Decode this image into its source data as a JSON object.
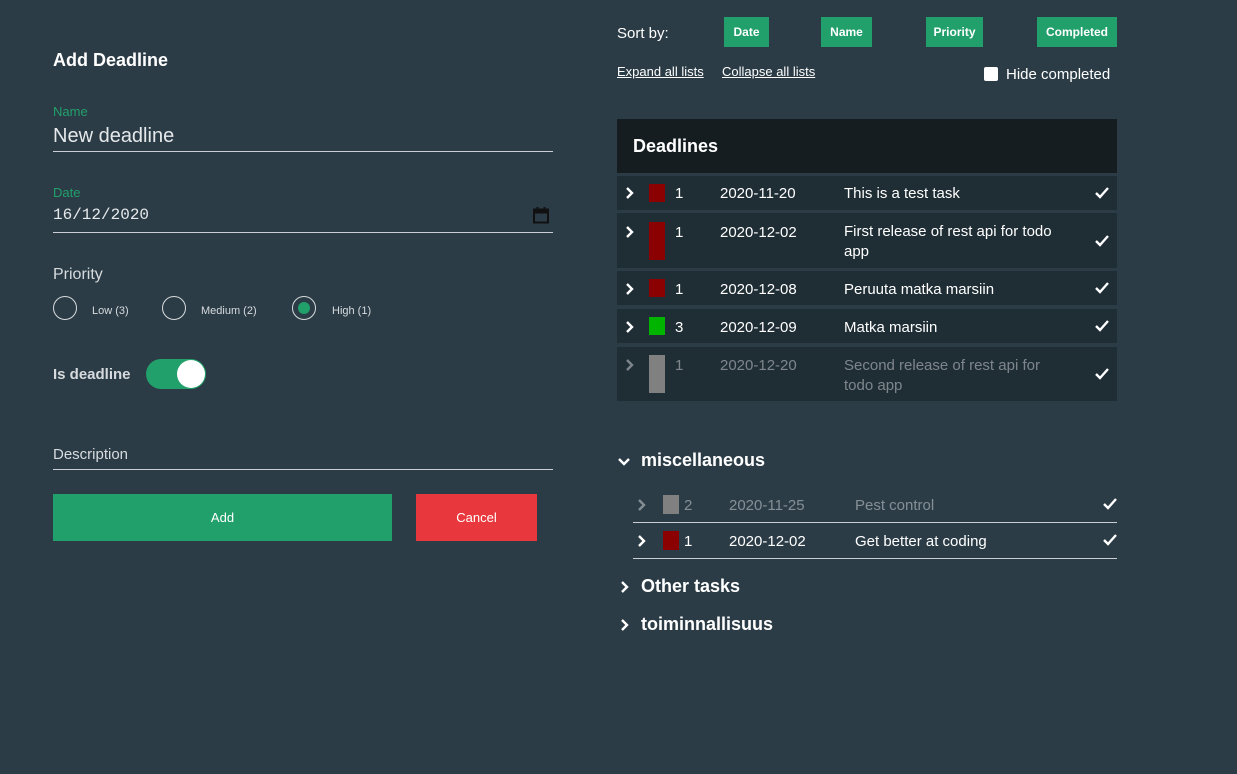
{
  "form": {
    "title": "Add Deadline",
    "name_label": "Name",
    "name_value": "New deadline",
    "date_label": "Date",
    "date_value": "16/12/2020",
    "priority_title": "Priority",
    "priority_options": [
      {
        "label": "Low (3)",
        "checked": false
      },
      {
        "label": "Medium (2)",
        "checked": false
      },
      {
        "label": "High (1)",
        "checked": true
      }
    ],
    "is_deadline_label": "Is deadline",
    "is_deadline_on": true,
    "description_placeholder": "Description",
    "add_label": "Add",
    "cancel_label": "Cancel"
  },
  "sort": {
    "label": "Sort by:",
    "buttons": [
      "Date",
      "Name",
      "Priority",
      "Completed"
    ]
  },
  "links": {
    "expand": "Expand all lists",
    "collapse": "Collapse all lists"
  },
  "hide_completed": {
    "label": "Hide completed",
    "checked": false
  },
  "deadlines": {
    "title": "Deadlines",
    "rows": [
      {
        "priority": "1",
        "color": "#8b0000",
        "date": "2020-11-20",
        "name": "This is a test task",
        "faded": false
      },
      {
        "priority": "1",
        "color": "#8b0000",
        "date": "2020-12-02",
        "name": "First release of rest api for todo app",
        "faded": false
      },
      {
        "priority": "1",
        "color": "#8b0000",
        "date": "2020-12-08",
        "name": "Peruuta matka marsiin",
        "faded": false
      },
      {
        "priority": "3",
        "color": "#00b400",
        "date": "2020-12-09",
        "name": "Matka marsiin",
        "faded": false
      },
      {
        "priority": "1",
        "color": "#808080",
        "date": "2020-12-20",
        "name": "Second release of rest api for todo app",
        "faded": true
      }
    ]
  },
  "groups": [
    {
      "name": "miscellaneous",
      "expanded": true,
      "rows": [
        {
          "priority": "2",
          "color": "#808080",
          "date": "2020-11-25",
          "name": "Pest control",
          "faded": true
        },
        {
          "priority": "1",
          "color": "#8b0000",
          "date": "2020-12-02",
          "name": "Get better at coding",
          "faded": false
        }
      ]
    },
    {
      "name": "Other tasks",
      "expanded": false
    },
    {
      "name": "toiminnallisuus",
      "expanded": false
    }
  ],
  "colors": {
    "background": "#2b3c46",
    "accent": "#22a06b",
    "cancel": "#e8383d",
    "row_bg": "#1f2d35",
    "header_bg": "#151d21"
  }
}
